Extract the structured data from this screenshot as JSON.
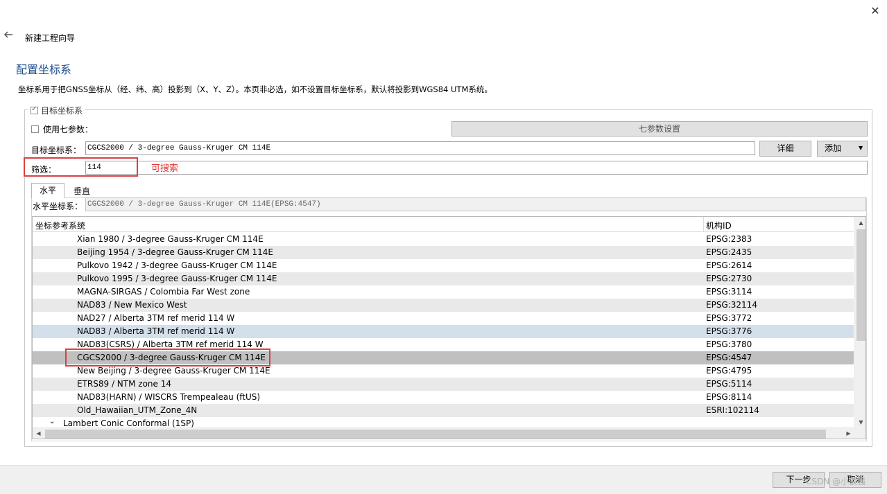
{
  "window": {
    "close_icon": "✕"
  },
  "header": {
    "back_icon": "🡐",
    "wizard_title": "新建工程向导",
    "page_title": "配置坐标系",
    "description": "坐标系用于把GNSS坐标从（经、纬、高）投影到（X、Y、Z）。本页非必选，如不设置目标坐标系，默认将投影到WGS84 UTM系统。"
  },
  "group": {
    "label": "目标坐标系",
    "checked": true,
    "use_seven_params_label": "使用七参数：",
    "seven_params_button": "七参数设置",
    "target_label": "目标坐标系：",
    "target_value": "CGCS2000 / 3-degree Gauss-Kruger CM 114E",
    "detail_button": "详细",
    "add_button": "添加",
    "filter_label": "筛选：",
    "filter_value": "114",
    "searchable_note": "可搜索"
  },
  "tabs": [
    {
      "label": "水平",
      "active": true
    },
    {
      "label": "垂直",
      "active": false
    }
  ],
  "horizontal": {
    "label": "水平坐标系：",
    "value": "CGCS2000 / 3-degree Gauss-Kruger CM 114E(EPSG:4547)"
  },
  "table": {
    "columns": [
      "坐标参考系统",
      "机构ID"
    ],
    "rows": [
      {
        "name": "Xian 1980 / 3-degree Gauss-Kruger CM 114E",
        "id": "EPSG:2383"
      },
      {
        "name": "Beijing 1954 / 3-degree Gauss-Kruger CM 114E",
        "id": "EPSG:2435"
      },
      {
        "name": "Pulkovo 1942 / 3-degree Gauss-Kruger CM 114E",
        "id": "EPSG:2614"
      },
      {
        "name": "Pulkovo 1995 / 3-degree Gauss-Kruger CM 114E",
        "id": "EPSG:2730"
      },
      {
        "name": "MAGNA-SIRGAS / Colombia Far West zone",
        "id": "EPSG:3114"
      },
      {
        "name": "NAD83 / New Mexico West",
        "id": "EPSG:32114"
      },
      {
        "name": "NAD27 / Alberta 3TM ref merid 114 W",
        "id": "EPSG:3772"
      },
      {
        "name": "NAD83 / Alberta 3TM ref merid 114 W",
        "id": "EPSG:3776"
      },
      {
        "name": "NAD83(CSRS) / Alberta 3TM ref merid 114 W",
        "id": "EPSG:3780"
      },
      {
        "name": "CGCS2000 / 3-degree Gauss-Kruger CM 114E",
        "id": "EPSG:4547"
      },
      {
        "name": "New Beijing / 3-degree Gauss-Kruger CM 114E",
        "id": "EPSG:4795"
      },
      {
        "name": "ETRS89 / NTM zone 14",
        "id": "EPSG:5114"
      },
      {
        "name": "NAD83(HARN) / WISCRS Trempealeau (ftUS)",
        "id": "EPSG:8114"
      },
      {
        "name": "Old_Hawaiian_UTM_Zone_4N",
        "id": "ESRI:102114"
      }
    ],
    "selected_index": 9,
    "hover_index": 7,
    "group_row": {
      "arrow_icon": "⌄",
      "label": "Lambert Conic Conformal (1SP)"
    }
  },
  "footer": {
    "next_button": "下一步",
    "cancel_button": "取消",
    "watermark": "CSDN @小狼强"
  }
}
